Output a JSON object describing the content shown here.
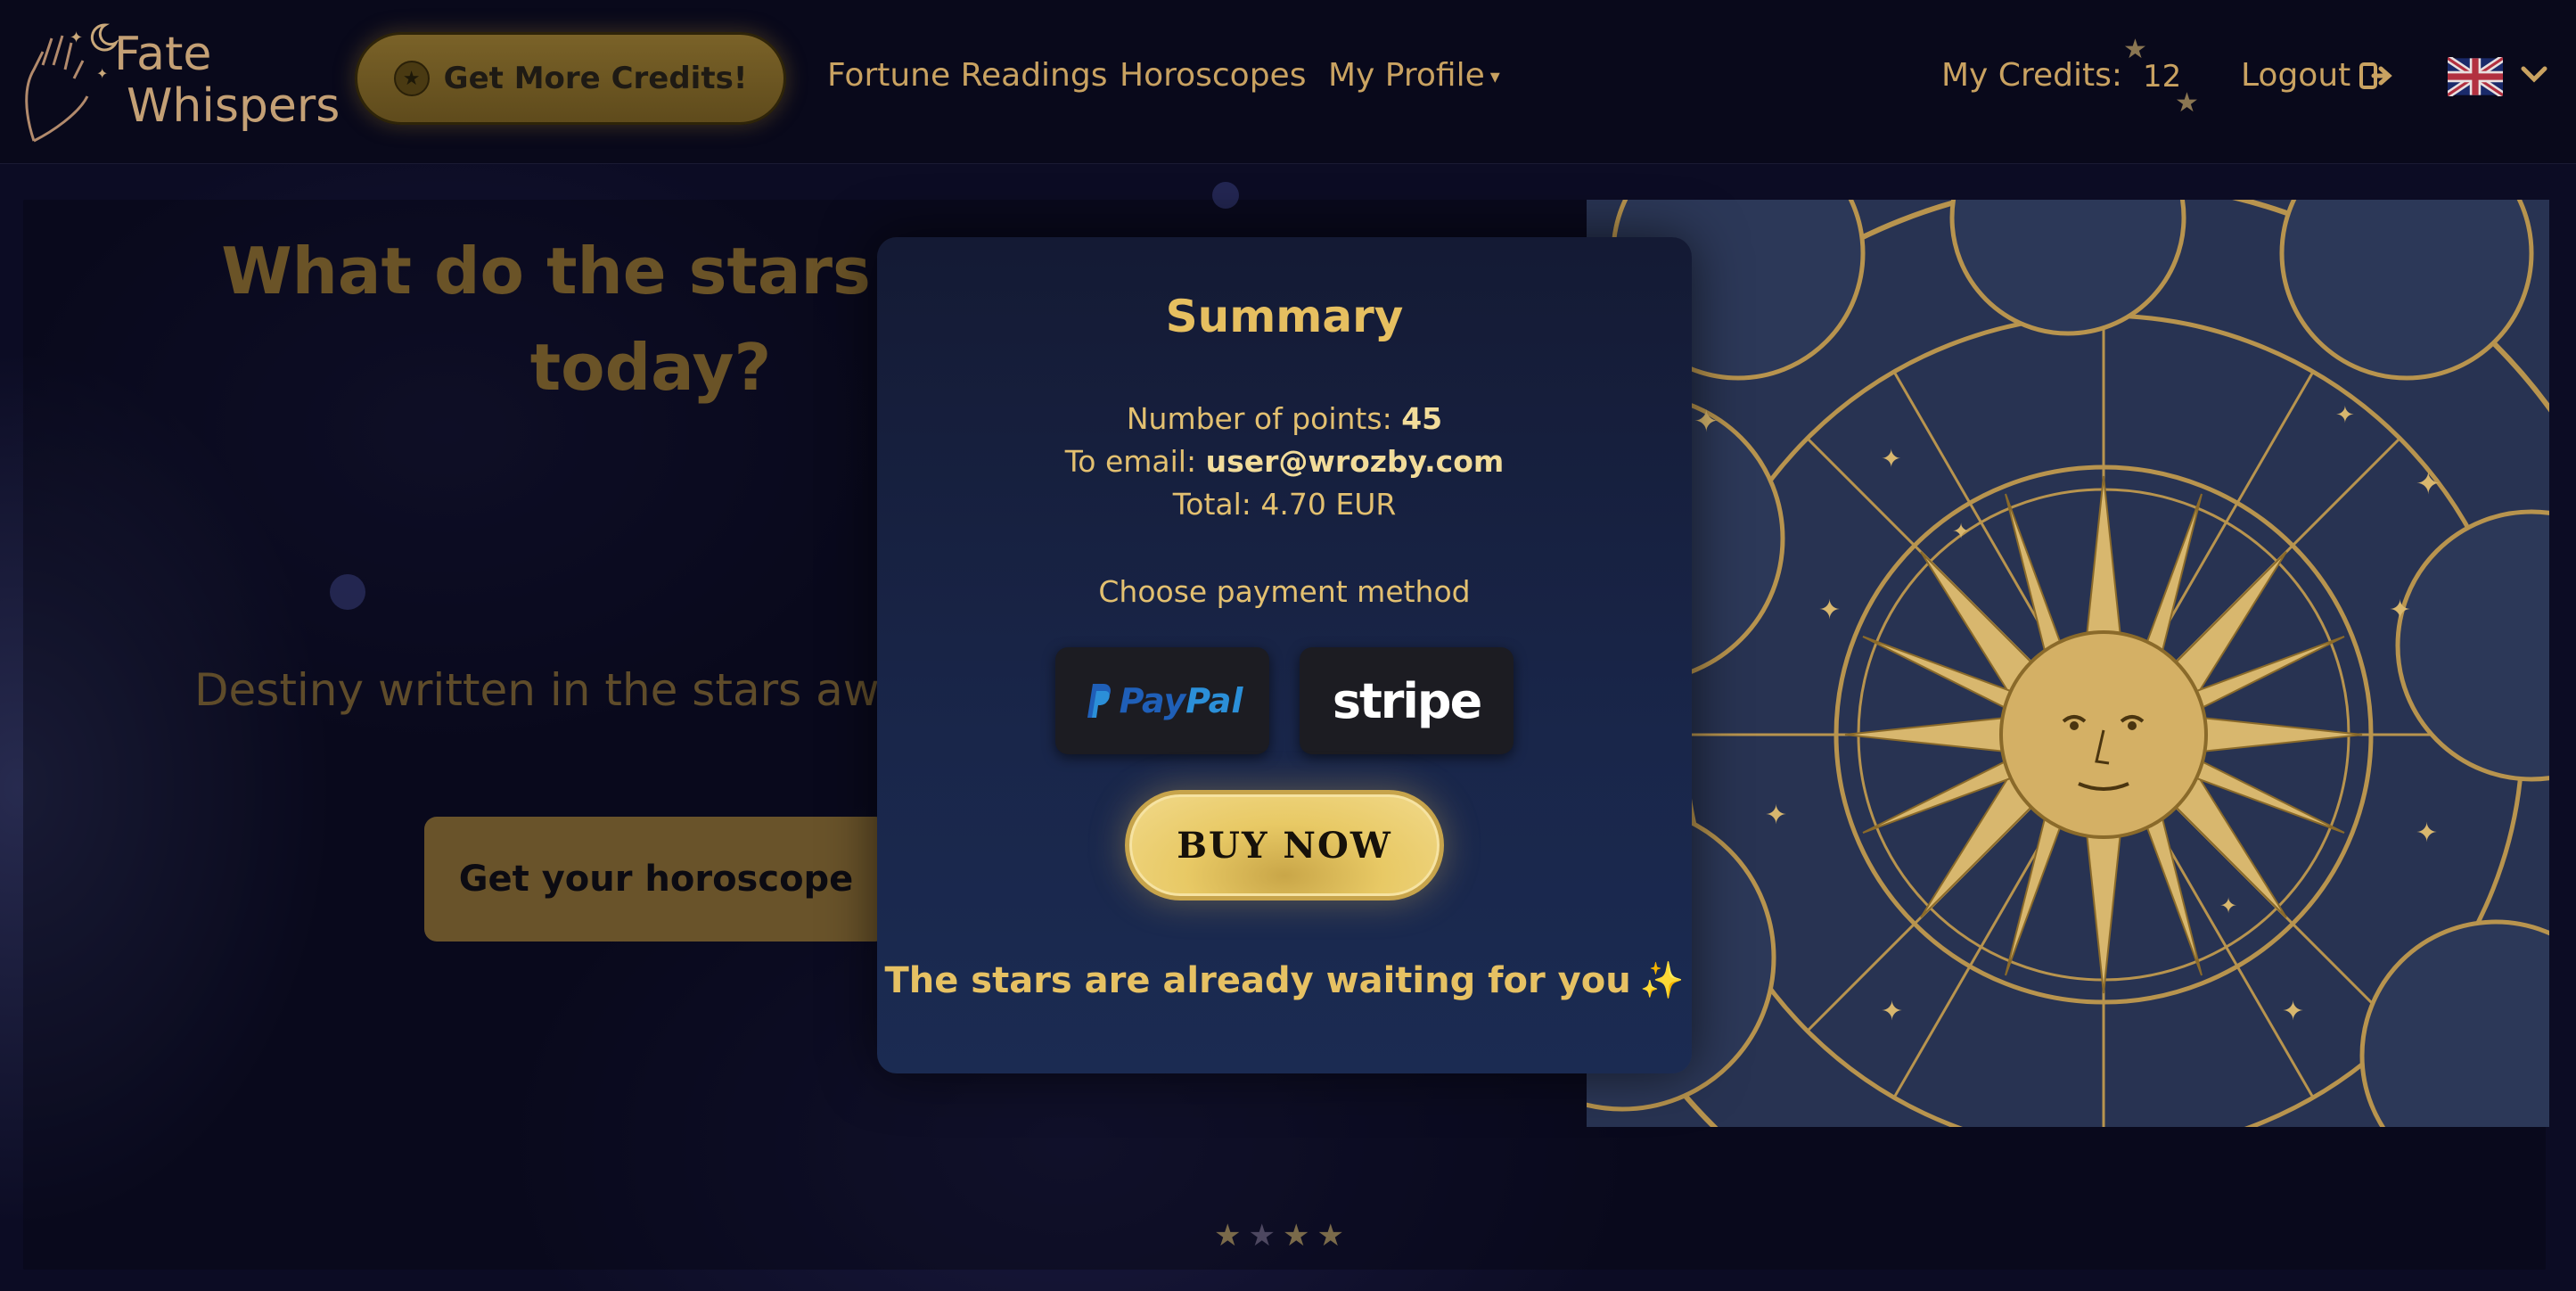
{
  "navbar": {
    "logo_line1": "Fate",
    "logo_line2": "Whispers",
    "get_credits_label": "Get More Credits!",
    "links": [
      "Fortune Readings",
      "Horoscopes",
      "My Profile"
    ],
    "my_credits_label": "My Credits:",
    "credits_value": "12",
    "logout_label": "Logout"
  },
  "hero": {
    "title": "What do the stars say a\ntoday?",
    "subtitle": "Destiny written in the stars await",
    "cta_label": "Get your horoscope",
    "rating_stars": 4
  },
  "modal": {
    "title": "Summary",
    "points_label": "Number of points:",
    "points_value": "45",
    "email_label": "To email:",
    "email_value": "user@wrozby.com",
    "total_label": "Total: 4.70 EUR",
    "choose_label": "Choose payment method",
    "paypal_pay": "Pay",
    "paypal_pal": "Pal",
    "stripe_label": "stripe",
    "buy_label": "BUY NOW",
    "footer_text": "The stars are already waiting for you",
    "footer_icon": "✨"
  },
  "colors": {
    "accent_gold": "#e6bf60",
    "nav_bg": "#09091b",
    "modal_bg": "#19264a"
  }
}
